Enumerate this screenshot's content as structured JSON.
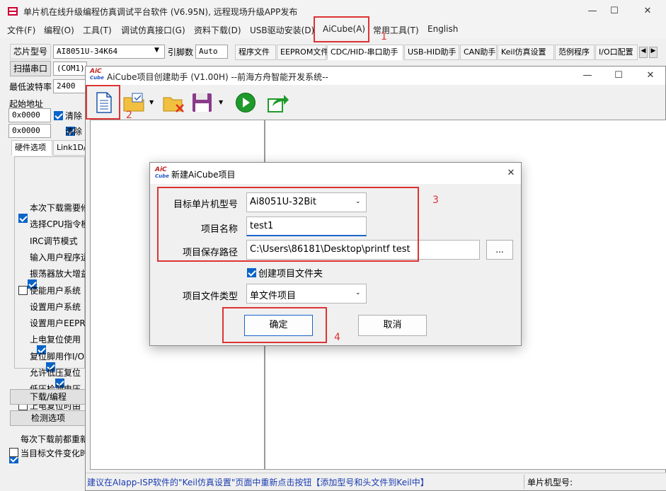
{
  "main": {
    "title": "单片机在线升级编程仿真调试平台软件 (V6.95N), 远程现场升级APP发布",
    "menu": [
      "文件(F)",
      "编程(O)",
      "工具(T)",
      "调试仿真接口(G)",
      "资料下载(D)",
      "USB驱动安装(D)",
      "AiCube(A)",
      "常用工具(T)",
      "English"
    ],
    "chip_label": "芯片型号",
    "chip_value": "AI8051U-34K64",
    "pin_label": "引脚数",
    "pin_value": "Auto",
    "scan_label": "扫描串口",
    "port_value": "(COM1)",
    "baud_label": "最低波特率",
    "baud_value": "2400",
    "start_addr_label": "起始地址",
    "addr1": "0x0000",
    "addr2": "0x0000",
    "clear1": "清除",
    "clear2": "清除",
    "hw_tab": "硬件选项",
    "link_tab": "Link1D/",
    "hw_options": [
      {
        "label": "本次下载需要修",
        "checked": true
      },
      {
        "label": "选择CPU指令模",
        "checked": null
      },
      {
        "label": "IRC调节模式",
        "checked": null
      },
      {
        "label": "输入用户程序运行",
        "checked": null
      },
      {
        "label": "振荡器放大增益",
        "checked": true
      },
      {
        "label": "使能用户系统",
        "checked": false
      },
      {
        "label": "设置用户系统",
        "checked": null
      },
      {
        "label": "设置用户EEPRO",
        "checked": null
      },
      {
        "label": "上电复位使用",
        "checked": true
      },
      {
        "label": "复位脚用作I/O",
        "checked": true
      },
      {
        "label": "允许低压复位",
        "checked": true
      },
      {
        "label": "低压检测电压",
        "checked": null
      },
      {
        "label": "上电复位时由",
        "checked": false
      }
    ],
    "download_button": "下载/编程",
    "detect_button": "检测选项",
    "reload_label": "每次下载前都重新",
    "target_change_label": "当目标文件变化时",
    "tabs": [
      "程序文件",
      "EEPROM文件",
      "CDC/HID-串口助手",
      "USB-HID助手",
      "CAN助手",
      "Keil仿真设置",
      "范例程序",
      "I/O口配置"
    ]
  },
  "aicube": {
    "title": "AiCube项目创建助手 (V1.00H) --前海方舟智能开发系统--",
    "logo_top": "AiC",
    "logo_bottom": "Cube",
    "status_text": "建议在AIapp-ISP软件的\"Keil仿真设置\"页面中重新点击按钮【添加型号和头文件到Keil中】",
    "status_mcu_label": "单片机型号:"
  },
  "dialog": {
    "title": "新建AiCube项目",
    "target_mcu_label": "目标单片机型号",
    "target_mcu_value": "Ai8051U-32Bit",
    "project_name_label": "项目名称",
    "project_name_value": "test1",
    "save_path_label": "项目保存路径",
    "save_path_value": "C:\\Users\\86181\\Desktop\\printf test",
    "browse_label": "...",
    "create_folder_label": "创建项目文件夹",
    "file_type_label": "项目文件类型",
    "file_type_value": "单文件项目",
    "ok_label": "确定",
    "cancel_label": "取消"
  },
  "annotations": {
    "n1": "1",
    "n2": "2",
    "n3": "3",
    "n4": "4"
  },
  "colors": {
    "annotation_red": "#dd3333",
    "checkbox_blue": "#0a64c8",
    "status_blue": "#1a3cb0"
  }
}
